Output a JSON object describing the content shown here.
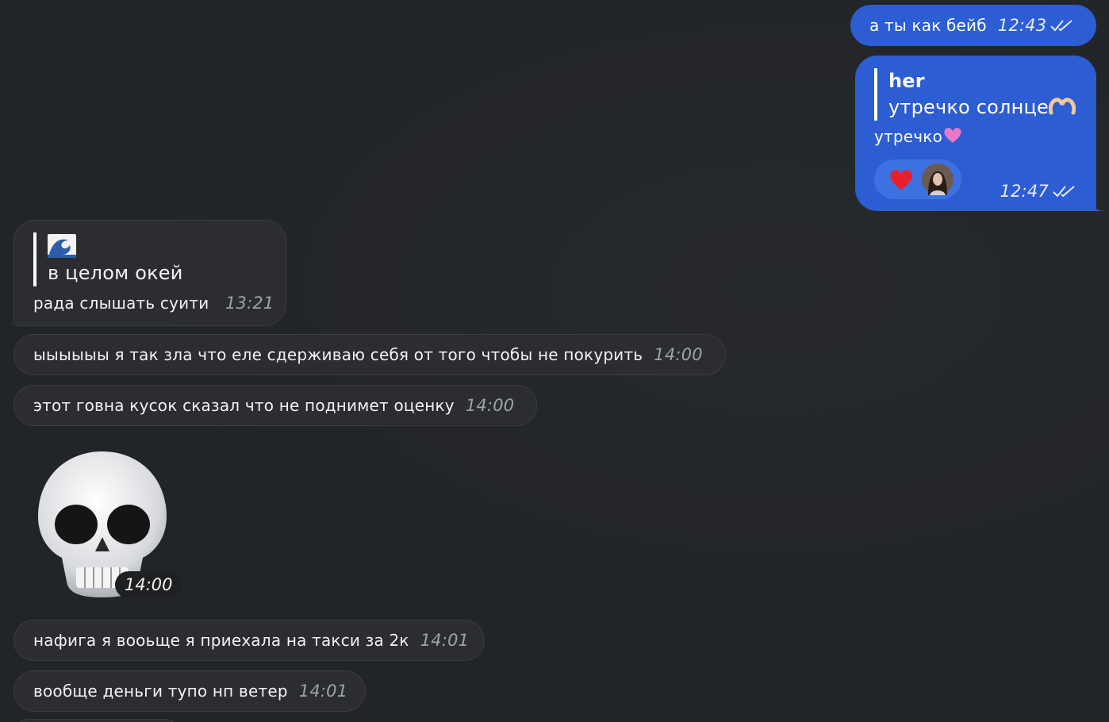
{
  "messages": [
    {
      "id": "m1",
      "direction": "outgoing",
      "text": "а ты как бейб",
      "time": "12:43",
      "status": "read-checks-icon"
    },
    {
      "id": "m2",
      "direction": "outgoing",
      "reply": {
        "author": "her",
        "text": "утречко солнце"
      },
      "text": "утречко",
      "reactions": [
        "red-heart-icon",
        "reactor-avatar"
      ],
      "time": "12:47",
      "status": "read-checks-icon"
    },
    {
      "id": "m3",
      "direction": "incoming",
      "reply": {
        "author_icon": "wave-emoji-icon",
        "text": "в целом окей"
      },
      "text": "рада слышать суити",
      "time": "13:21"
    },
    {
      "id": "m4",
      "direction": "incoming",
      "text": "ыыыыыы я так зла что еле сдерживаю себя от того чтобы не покурить",
      "time": "14:00"
    },
    {
      "id": "m5",
      "direction": "incoming",
      "text": "этот говна кусок сказал что не поднимет оценку",
      "time": "14:00"
    },
    {
      "id": "m6",
      "direction": "incoming",
      "sticker": "skull-emoji-icon",
      "time": "14:00"
    },
    {
      "id": "m7",
      "direction": "incoming",
      "text": "нафига я вооьще я приехала на такси за 2к",
      "time": "14:01"
    },
    {
      "id": "m8",
      "direction": "incoming",
      "text": "вообще деньги тупо нп ветер",
      "time": "14:01"
    }
  ],
  "colors": {
    "background": "#222528",
    "incoming_bubble": "#2b2d30",
    "outgoing_bubble": "#2c5dd3",
    "time_incoming": "#9aa3ad"
  }
}
